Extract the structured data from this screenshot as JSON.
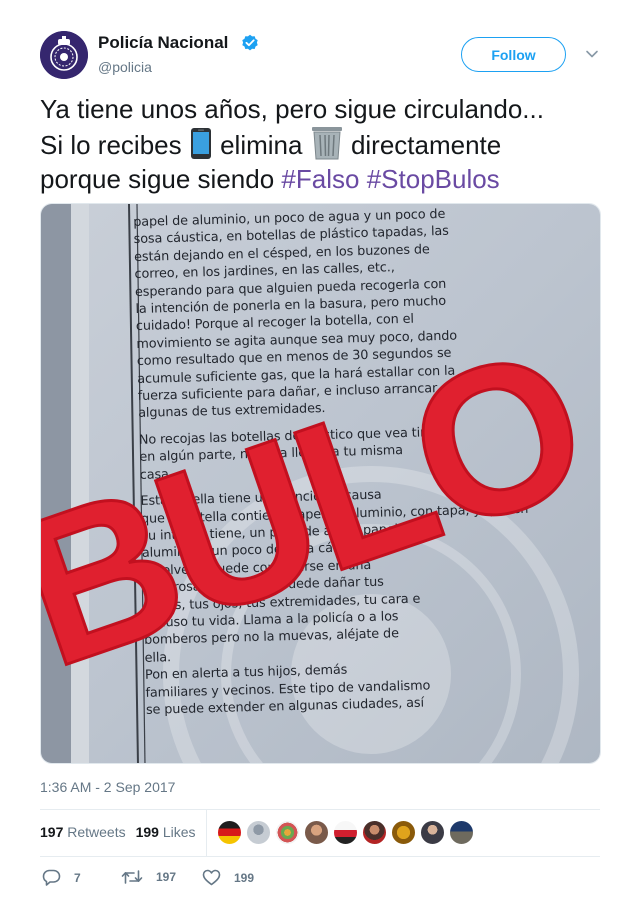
{
  "account": {
    "name": "Policía Nacional",
    "handle": "@policia",
    "verified": true,
    "follow_label": "Follow"
  },
  "tweet": {
    "line1": "Ya tiene unos años, pero sigue circulando...",
    "line2_a": "Si lo recibes",
    "line2_b": "elimina",
    "line2_c": "directamente",
    "line3_a": "porque sigue siendo",
    "hashtag1": "#Falso",
    "hashtag2": "#StopBulos",
    "emojis": [
      "mobile-phone-icon",
      "wastebasket-icon"
    ]
  },
  "photo": {
    "stamp": "BULO",
    "note_lines": [
      "papel de aluminio, un poco de agua y un poco de",
      "sosa cáustica, en botellas de plástico tapadas, las",
      "están dejando en el césped, en los buzones de",
      "correo, en los jardines, en las calles, etc.,",
      "esperando para que alguien pueda recogerla con",
      "la intención de ponerla en la basura, pero mucho",
      "cuidado! Porque al recoger la botella, con el",
      "movimiento se agita aunque sea muy poco, dando",
      "como resultado que en menos de 30 segundos se",
      "acumule suficiente gas, que la hará estallar con la",
      "fuerza suficiente para dañar, e incluso arrancar",
      "algunas de tus extremidades.",
      "",
      "No recojas las botellas de plástico que vea tirada",
      "en algún parte, no te la lleves a tu misma",
      "casa",
      "",
      "Esta botella tiene una función a causa",
      "que la botella contiene papel de aluminio, con tapa, y que en",
      "su interior tiene, un poco de agua, papel",
      "aluminio y un poco de sosa cáustica, al",
      "revolverla puede convertirse en una",
      "peligrosa bomba que puede dañar tus",
      "dedos, tus ojos, tus extremidades, tu cara e",
      "incluso tu vida. Llama a la policía o a los",
      "bomberos pero no la muevas, aléjate de",
      "ella.",
      "Pon en alerta a tus hijos, demás",
      "familiares y vecinos. Este tipo de vandalismo",
      "se puede extender en algunas ciudades, así"
    ]
  },
  "meta": {
    "timestamp": "1:36 AM - 2 Sep 2017",
    "retweets_count": "197",
    "retweets_label": "Retweets",
    "likes_count": "199",
    "likes_label": "Likes"
  },
  "actions": {
    "reply_count": "7",
    "retweet_count": "197",
    "like_count": "199"
  },
  "colors": {
    "brand_blue": "#1da1f2",
    "hashtag": "#6a4aa3",
    "stamp_red": "#e0202f",
    "muted": "#657786"
  }
}
